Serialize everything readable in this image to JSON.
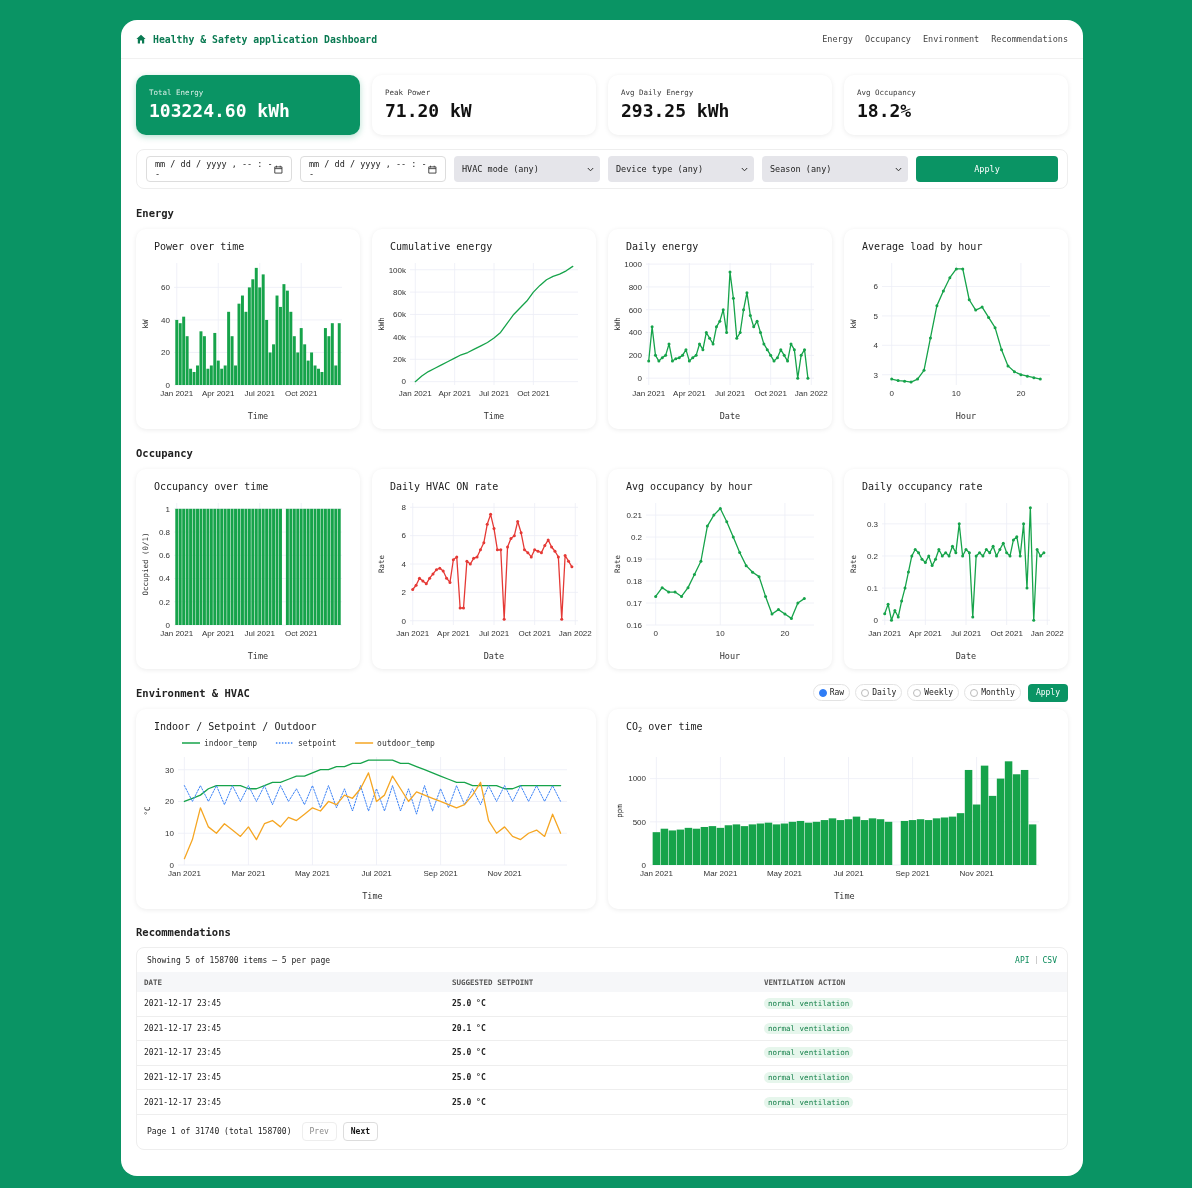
{
  "header": {
    "title": "Healthy & Safety application Dashboard",
    "nav": [
      "Energy",
      "Occupancy",
      "Environment",
      "Recommendations"
    ]
  },
  "stats": [
    {
      "label": "Total Energy",
      "value": "103224.60 kWh",
      "selected": true
    },
    {
      "label": "Peak Power",
      "value": "71.20 kW",
      "selected": false
    },
    {
      "label": "Avg Daily Energy",
      "value": "293.25 kWh",
      "selected": false
    },
    {
      "label": "Avg Occupancy",
      "value": "18.2%",
      "selected": false
    }
  ],
  "filters": {
    "date_from": {
      "placeholder": "mm / dd / yyyy , -- : --"
    },
    "date_to": {
      "placeholder": "mm / dd / yyyy , -- : --"
    },
    "selects": [
      "HVAC mode (any)",
      "Device type (any)",
      "Season (any)"
    ],
    "apply": "Apply"
  },
  "sections": [
    {
      "title": "Energy",
      "charts": [
        {
          "chart_data": {
            "type": "bar",
            "title": "Power over time",
            "xlabel": "Time",
            "ylabel": "kW",
            "grid": true,
            "categories": [
              "Jan 2021",
              null,
              null,
              null,
              null,
              null,
              null,
              null,
              null,
              null,
              null,
              null,
              "Apr 2021",
              null,
              null,
              null,
              null,
              null,
              null,
              null,
              null,
              null,
              null,
              null,
              "Jul 2021",
              null,
              null,
              null,
              null,
              null,
              null,
              null,
              null,
              null,
              null,
              null,
              "Oct 2021",
              null,
              null,
              null,
              null,
              null,
              null,
              null,
              null,
              null,
              null,
              null
            ],
            "ylim": [
              0,
              75
            ],
            "yticks": [
              0,
              20,
              40,
              60
            ],
            "series": [
              {
                "color": "#16a34a",
                "values": [
                  40,
                  38,
                  42,
                  30,
                  10,
                  8,
                  12,
                  33,
                  30,
                  10,
                  12,
                  32,
                  15,
                  10,
                  12,
                  45,
                  30,
                  12,
                  50,
                  55,
                  45,
                  60,
                  65,
                  72,
                  60,
                  68,
                  40,
                  20,
                  25,
                  55,
                  48,
                  62,
                  58,
                  45,
                  30,
                  20,
                  35,
                  25,
                  15,
                  20,
                  12,
                  10,
                  8,
                  35,
                  30,
                  38,
                  12,
                  38
                ]
              }
            ]
          }
        },
        {
          "chart_data": {
            "type": "line",
            "title": "Cumulative energy",
            "xlabel": "Time",
            "ylabel": "kWh",
            "grid": true,
            "categories": [
              "Jan 2021",
              null,
              null,
              null,
              null,
              null,
              "Apr 2021",
              null,
              null,
              null,
              null,
              null,
              "Jul 2021",
              null,
              null,
              null,
              null,
              null,
              "Oct 2021",
              null,
              null,
              null,
              null,
              null,
              null
            ],
            "ylim": [
              -3000,
              106000
            ],
            "yticks": [
              {
                "value": 0,
                "label": "0"
              },
              {
                "value": 20000,
                "label": "20k"
              },
              {
                "value": 40000,
                "label": "40k"
              },
              {
                "value": 60000,
                "label": "60k"
              },
              {
                "value": 80000,
                "label": "80k"
              },
              {
                "value": 100000,
                "label": "100k"
              }
            ],
            "series": [
              {
                "color": "#16a34a",
                "values": [
                  0,
                  5000,
                  9000,
                  12000,
                  15000,
                  18000,
                  21000,
                  24000,
                  26000,
                  29000,
                  32000,
                  35000,
                  39000,
                  44000,
                  52000,
                  60000,
                  66000,
                  72000,
                  80000,
                  86000,
                  91000,
                  94000,
                  96000,
                  99000,
                  103000
                ]
              }
            ]
          }
        },
        {
          "chart_data": {
            "type": "line",
            "title": "Daily energy",
            "xlabel": "Date",
            "ylabel": "kWh",
            "grid": true,
            "categories": [
              "Jan 2021",
              null,
              null,
              null,
              null,
              null,
              null,
              null,
              null,
              null,
              null,
              null,
              "Apr 2021",
              null,
              null,
              null,
              null,
              null,
              null,
              null,
              null,
              null,
              null,
              null,
              "Jul 2021",
              null,
              null,
              null,
              null,
              null,
              null,
              null,
              null,
              null,
              null,
              null,
              "Oct 2021",
              null,
              null,
              null,
              null,
              null,
              null,
              null,
              null,
              null,
              null,
              null,
              "Jan 2022"
            ],
            "ylim": [
              -60,
              1010
            ],
            "yticks": [
              0,
              200,
              400,
              600,
              800,
              1000
            ],
            "series": [
              {
                "color": "#16a34a",
                "values": [
                  150,
                  450,
                  200,
                  150,
                  180,
                  200,
                  300,
                  150,
                  170,
                  180,
                  200,
                  250,
                  150,
                  180,
                  200,
                  300,
                  250,
                  400,
                  350,
                  300,
                  450,
                  500,
                  600,
                  400,
                  930,
                  700,
                  350,
                  400,
                  600,
                  750,
                  550,
                  450,
                  500,
                  400,
                  300,
                  250,
                  200,
                  150,
                  180,
                  250,
                  200,
                  150,
                  300,
                  250,
                  0,
                  200,
                  250,
                  0,
                  null
                ]
              }
            ]
          }
        },
        {
          "chart_data": {
            "type": "line",
            "title": "Average load by hour",
            "xlabel": "Hour",
            "ylabel": "kW",
            "grid": true,
            "x": [
              0,
              1,
              2,
              3,
              4,
              5,
              6,
              7,
              8,
              9,
              10,
              11,
              12,
              13,
              14,
              15,
              16,
              17,
              18,
              19,
              20,
              21,
              22,
              23
            ],
            "xlim": [
              -1.5,
              24.5
            ],
            "ylim": [
              2.65,
              6.8
            ],
            "xticks": [
              0,
              10,
              20
            ],
            "yticks": [
              3,
              4,
              5,
              6
            ],
            "series": [
              {
                "color": "#16a34a",
                "values": [
                  2.85,
                  2.8,
                  2.78,
                  2.75,
                  2.85,
                  3.15,
                  4.25,
                  5.35,
                  5.85,
                  6.3,
                  6.6,
                  6.6,
                  5.55,
                  5.2,
                  5.3,
                  4.95,
                  4.6,
                  3.85,
                  3.3,
                  3.1,
                  3.0,
                  2.95,
                  2.9,
                  2.85
                ]
              }
            ]
          }
        }
      ]
    },
    {
      "title": "Occupancy",
      "charts": [
        {
          "chart_data": {
            "type": "bar",
            "title": "Occupancy over time",
            "xlabel": "Time",
            "ylabel": "Occupied (0/1)",
            "grid": true,
            "categories": [
              "Jan 2021",
              null,
              null,
              null,
              null,
              null,
              null,
              null,
              null,
              null,
              null,
              null,
              "Apr 2021",
              null,
              null,
              null,
              null,
              null,
              null,
              null,
              null,
              null,
              null,
              null,
              "Jul 2021",
              null,
              null,
              null,
              null,
              null,
              null,
              null,
              null,
              null,
              null,
              null,
              "Oct 2021",
              null,
              null,
              null,
              null,
              null,
              null,
              null,
              null,
              null,
              null,
              null
            ],
            "ylim": [
              0,
              1.05
            ],
            "yticks": [
              0,
              0.2,
              0.4,
              0.6,
              0.8,
              1
            ],
            "series": [
              {
                "color": "#16a34a",
                "values": [
                  1,
                  1,
                  1,
                  1,
                  1,
                  1,
                  1,
                  1,
                  1,
                  1,
                  1,
                  1,
                  1,
                  1,
                  1,
                  1,
                  1,
                  1,
                  1,
                  1,
                  1,
                  1,
                  1,
                  1,
                  1,
                  1,
                  1,
                  1,
                  1,
                  1,
                  1,
                  0,
                  1,
                  1,
                  1,
                  1,
                  1,
                  1,
                  1,
                  1,
                  1,
                  1,
                  1,
                  1,
                  1,
                  1,
                  1,
                  1
                ]
              }
            ]
          }
        },
        {
          "chart_data": {
            "type": "line",
            "title": "Daily HVAC ON rate",
            "xlabel": "Date",
            "ylabel": "Rate",
            "grid": true,
            "categories": [
              "Jan 2021",
              null,
              null,
              null,
              null,
              null,
              null,
              null,
              null,
              null,
              null,
              null,
              "Apr 2021",
              null,
              null,
              null,
              null,
              null,
              null,
              null,
              null,
              null,
              null,
              null,
              "Jul 2021",
              null,
              null,
              null,
              null,
              null,
              null,
              null,
              null,
              null,
              null,
              null,
              "Oct 2021",
              null,
              null,
              null,
              null,
              null,
              null,
              null,
              null,
              null,
              null,
              null,
              "Jan 2022"
            ],
            "ylim": [
              -0.3,
              8.3
            ],
            "yticks": [
              0,
              2,
              4,
              6,
              8
            ],
            "series": [
              {
                "color": "#e53935",
                "values": [
                  2.2,
                  2.5,
                  3.0,
                  2.8,
                  2.6,
                  3.0,
                  3.3,
                  3.6,
                  3.7,
                  3.5,
                  3.0,
                  2.7,
                  4.3,
                  4.5,
                  0.9,
                  0.9,
                  4.2,
                  4.0,
                  4.4,
                  4.5,
                  5.0,
                  5.5,
                  6.8,
                  7.5,
                  6.5,
                  5.0,
                  5.0,
                  0.1,
                  5.2,
                  5.8,
                  6.0,
                  7.0,
                  6.2,
                  5.0,
                  4.8,
                  4.5,
                  5.0,
                  4.9,
                  4.8,
                  5.3,
                  5.7,
                  5.2,
                  4.9,
                  4.5,
                  0.1,
                  4.6,
                  4.2,
                  3.8,
                  null
                ]
              }
            ]
          }
        },
        {
          "chart_data": {
            "type": "line",
            "title": "Avg occupancy by hour",
            "xlabel": "Hour",
            "ylabel": "Rate",
            "grid": true,
            "x": [
              0,
              1,
              2,
              3,
              4,
              5,
              6,
              7,
              8,
              9,
              10,
              11,
              12,
              13,
              14,
              15,
              16,
              17,
              18,
              19,
              20,
              21,
              22,
              23
            ],
            "xlim": [
              -1.5,
              24.5
            ],
            "ylim": [
              0.16,
              0.2155
            ],
            "xticks": [
              0,
              10,
              20
            ],
            "yticks": [
              0.16,
              0.17,
              0.18,
              0.19,
              0.2,
              0.21
            ],
            "series": [
              {
                "color": "#16a34a",
                "values": [
                  0.173,
                  0.177,
                  0.175,
                  0.175,
                  0.173,
                  0.177,
                  0.183,
                  0.189,
                  0.205,
                  0.21,
                  0.213,
                  0.207,
                  0.2,
                  0.193,
                  0.187,
                  0.184,
                  0.182,
                  0.173,
                  0.165,
                  0.167,
                  0.165,
                  0.163,
                  0.17,
                  0.172
                ]
              }
            ]
          }
        },
        {
          "chart_data": {
            "type": "line",
            "title": "Daily occupancy rate",
            "xlabel": "Date",
            "ylabel": "Rate",
            "grid": true,
            "categories": [
              "Jan 2021",
              null,
              null,
              null,
              null,
              null,
              null,
              null,
              null,
              null,
              null,
              null,
              "Apr 2021",
              null,
              null,
              null,
              null,
              null,
              null,
              null,
              null,
              null,
              null,
              null,
              "Jul 2021",
              null,
              null,
              null,
              null,
              null,
              null,
              null,
              null,
              null,
              null,
              null,
              "Oct 2021",
              null,
              null,
              null,
              null,
              null,
              null,
              null,
              null,
              null,
              null,
              null,
              "Jan 2022"
            ],
            "ylim": [
              -0.015,
              0.365
            ],
            "yticks": [
              0,
              0.1,
              0.2,
              0.3
            ],
            "series": [
              {
                "color": "#16a34a",
                "values": [
                  0.02,
                  0.05,
                  0.0,
                  0.03,
                  0.01,
                  0.06,
                  0.1,
                  0.15,
                  0.2,
                  0.22,
                  0.21,
                  0.19,
                  0.18,
                  0.2,
                  0.17,
                  0.19,
                  0.22,
                  0.2,
                  0.21,
                  0.2,
                  0.23,
                  0.21,
                  0.3,
                  0.2,
                  0.22,
                  0.21,
                  0.01,
                  0.2,
                  0.21,
                  0.2,
                  0.22,
                  0.21,
                  0.23,
                  0.2,
                  0.22,
                  0.24,
                  0.21,
                  0.2,
                  0.25,
                  0.26,
                  0.2,
                  0.3,
                  0.1,
                  0.35,
                  0.0,
                  0.22,
                  0.2,
                  0.21,
                  null
                ]
              }
            ]
          }
        }
      ]
    },
    {
      "title": "Environment & HVAC",
      "aggregation": [
        {
          "label": "Raw",
          "selected": true
        },
        {
          "label": "Daily",
          "selected": false
        },
        {
          "label": "Weekly",
          "selected": false
        },
        {
          "label": "Monthly",
          "selected": false
        }
      ],
      "apply": "Apply",
      "charts": [
        {
          "chart_data": {
            "type": "line",
            "title": "Indoor / Setpoint / Outdoor",
            "xlabel": "Time",
            "ylabel": "°C",
            "grid": true,
            "legend": "top-left",
            "categories": [
              "Jan 2021",
              null,
              null,
              null,
              null,
              null,
              null,
              null,
              "Mar 2021",
              null,
              null,
              null,
              null,
              null,
              null,
              null,
              "May 2021",
              null,
              null,
              null,
              null,
              null,
              null,
              null,
              "Jul 2021",
              null,
              null,
              null,
              null,
              null,
              null,
              null,
              "Sep 2021",
              null,
              null,
              null,
              null,
              null,
              null,
              null,
              "Nov 2021",
              null,
              null,
              null,
              null,
              null,
              null,
              null
            ],
            "ylim": [
              0,
              34
            ],
            "yticks": [
              0,
              10,
              20,
              30
            ],
            "series": [
              {
                "name": "indoor_temp",
                "color": "#16a34a",
                "values": [
                  20,
                  21,
                  22,
                  24,
                  25,
                  25,
                  25,
                  25,
                  24,
                  24,
                  25,
                  26,
                  26,
                  27,
                  28,
                  28,
                  29,
                  30,
                  30,
                  31,
                  31,
                  32,
                  32,
                  33,
                  33,
                  33,
                  33,
                  32,
                  32,
                  31,
                  30,
                  29,
                  28,
                  27,
                  26,
                  26,
                  25,
                  25,
                  25,
                  25,
                  24,
                  24,
                  25,
                  25,
                  25,
                  25,
                  25,
                  25
                ]
              },
              {
                "name": "setpoint",
                "color": "#3b82f6",
                "line_style": "dotted",
                "values": [
                  25,
                  20,
                  25,
                  20,
                  25,
                  19,
                  25,
                  20,
                  25,
                  20,
                  25,
                  19,
                  25,
                  20,
                  24,
                  19,
                  25,
                  18,
                  25,
                  18,
                  24,
                  17,
                  25,
                  17,
                  24,
                  17,
                  25,
                  17,
                  24,
                  16,
                  25,
                  17,
                  24,
                  18,
                  25,
                  19,
                  24,
                  19,
                  25,
                  20,
                  25,
                  20,
                  25,
                  20,
                  25,
                  20,
                  25,
                  20
                ]
              },
              {
                "name": "outdoor_temp",
                "color": "#f5a623",
                "values": [
                  2,
                  8,
                  18,
                  12,
                  10,
                  13,
                  11,
                  9,
                  12,
                  8,
                  13,
                  14,
                  12,
                  15,
                  14,
                  16,
                  18,
                  17,
                  20,
                  19,
                  22,
                  21,
                  24,
                  29,
                  20,
                  22,
                  28,
                  24,
                  20,
                  23,
                  22,
                  21,
                  20,
                  19,
                  18,
                  19,
                  22,
                  26,
                  14,
                  10,
                  12,
                  9,
                  8,
                  10,
                  11,
                  9,
                  16,
                  10
                ]
              }
            ]
          }
        },
        {
          "title_rich": "CO$_{2}$ over time",
          "chart_data": {
            "type": "bar",
            "xlabel": "Time",
            "ylabel": "ppm",
            "grid": true,
            "categories": [
              "Jan 2021",
              null,
              null,
              null,
              null,
              null,
              null,
              null,
              "Mar 2021",
              null,
              null,
              null,
              null,
              null,
              null,
              null,
              "May 2021",
              null,
              null,
              null,
              null,
              null,
              null,
              null,
              "Jul 2021",
              null,
              null,
              null,
              null,
              null,
              null,
              null,
              "Sep 2021",
              null,
              null,
              null,
              null,
              null,
              null,
              null,
              "Nov 2021",
              null,
              null,
              null,
              null,
              null,
              null,
              null
            ],
            "ylim": [
              0,
              1250
            ],
            "yticks": [
              0,
              500,
              1000
            ],
            "series": [
              {
                "color": "#16a34a",
                "values": [
                  380,
                  420,
                  400,
                  410,
                  430,
                  420,
                  440,
                  450,
                  430,
                  460,
                  470,
                  450,
                  470,
                  480,
                  490,
                  470,
                  480,
                  500,
                  510,
                  490,
                  500,
                  520,
                  540,
                  520,
                  530,
                  560,
                  520,
                  540,
                  530,
                  500,
                  0,
                  510,
                  520,
                  530,
                  520,
                  540,
                  550,
                  560,
                  600,
                  1100,
                  700,
                  1150,
                  800,
                  1000,
                  1200,
                  1050,
                  1100,
                  470
                ]
              }
            ]
          }
        }
      ]
    }
  ],
  "recommendations": {
    "title": "Recommendations",
    "summary": "Showing 5 of 158700 items — 5 per page",
    "links": [
      "API",
      "CSV"
    ],
    "columns": [
      "DATE",
      "SUGGESTED SETPOINT",
      "VENTILATION ACTION"
    ],
    "rows": [
      {
        "date": "2021-12-17 23:45",
        "setpoint": "25.0 °C",
        "action": "normal ventilation"
      },
      {
        "date": "2021-12-17 23:45",
        "setpoint": "20.1 °C",
        "action": "normal ventilation"
      },
      {
        "date": "2021-12-17 23:45",
        "setpoint": "25.0 °C",
        "action": "normal ventilation"
      },
      {
        "date": "2021-12-17 23:45",
        "setpoint": "25.0 °C",
        "action": "normal ventilation"
      },
      {
        "date": "2021-12-17 23:45",
        "setpoint": "25.0 °C",
        "action": "normal ventilation"
      }
    ],
    "page_info": "Page 1 of 31740 (total 158700)",
    "prev": {
      "label": "Prev",
      "disabled": true
    },
    "next": {
      "label": "Next",
      "disabled": false
    }
  }
}
